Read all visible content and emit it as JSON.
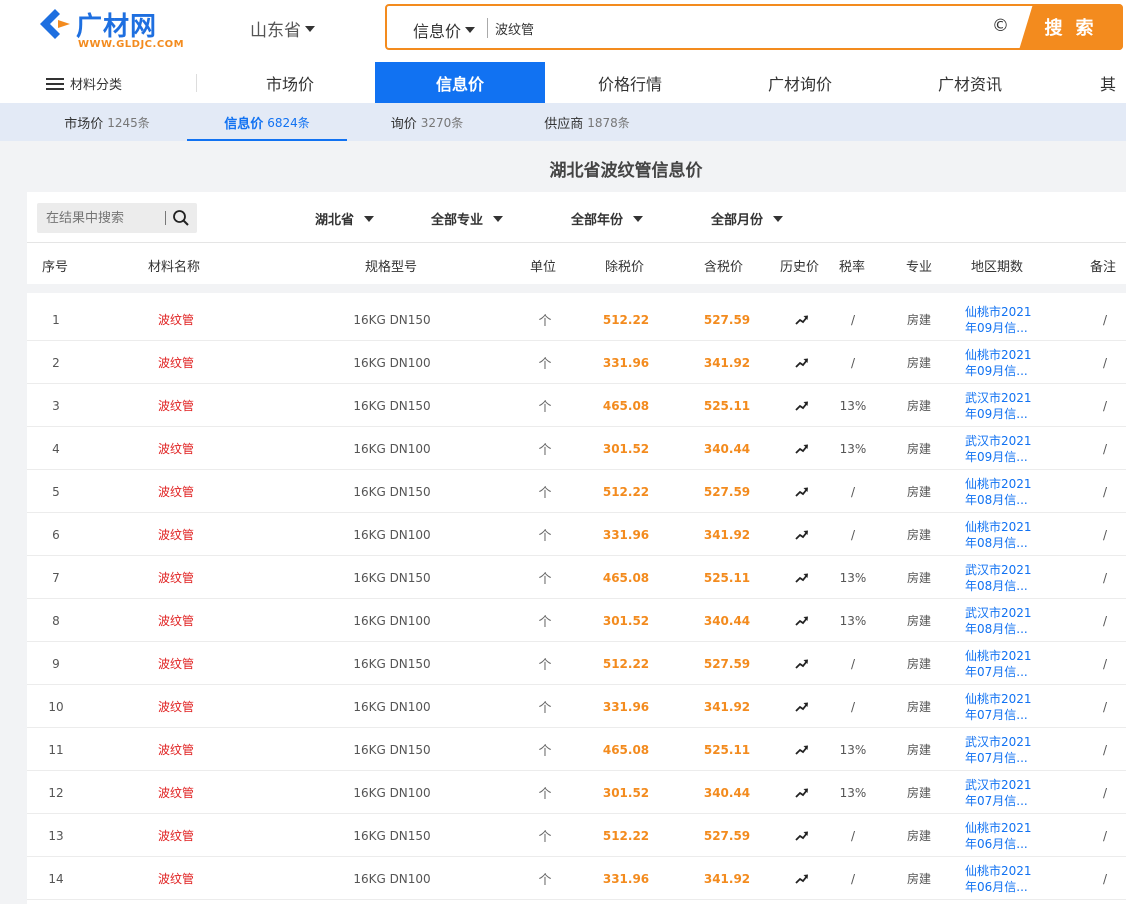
{
  "header": {
    "logo_text": "广材网",
    "logo_url": "WWW.GLDJC.COM",
    "province": "山东省",
    "search_type": "信息价",
    "search_value": "波纹管",
    "search_button": "搜 索"
  },
  "nav": {
    "category": "材料分类",
    "items": [
      {
        "label": "市场价"
      },
      {
        "label": "信息价"
      },
      {
        "label": "价格行情"
      },
      {
        "label": "广材询价"
      },
      {
        "label": "广材资讯"
      },
      {
        "label": "其"
      }
    ],
    "active_index": 1
  },
  "subtabs": [
    {
      "label": "市场价",
      "count": "1245条"
    },
    {
      "label": "信息价",
      "count": "6824条"
    },
    {
      "label": "询价",
      "count": "3270条"
    },
    {
      "label": "供应商",
      "count": "1878条"
    }
  ],
  "page_title": "湖北省波纹管信息价",
  "filters": {
    "search_placeholder": "在结果中搜索",
    "region": "湖北省",
    "major": "全部专业",
    "year": "全部年份",
    "month": "全部月份"
  },
  "columns": [
    "序号",
    "材料名称",
    "规格型号",
    "单位",
    "除税价",
    "含税价",
    "历史价",
    "税率",
    "专业",
    "地区期数",
    "备注"
  ],
  "rows": [
    {
      "no": "1",
      "name": "波纹管",
      "spec": "16KG DN150",
      "unit": "个",
      "price": "512.22",
      "tax_price": "527.59",
      "rate": "/",
      "major": "房建",
      "region1": "仙桃市2021",
      "region2": "年09月信...",
      "note": "/"
    },
    {
      "no": "2",
      "name": "波纹管",
      "spec": "16KG DN100",
      "unit": "个",
      "price": "331.96",
      "tax_price": "341.92",
      "rate": "/",
      "major": "房建",
      "region1": "仙桃市2021",
      "region2": "年09月信...",
      "note": "/"
    },
    {
      "no": "3",
      "name": "波纹管",
      "spec": "16KG DN150",
      "unit": "个",
      "price": "465.08",
      "tax_price": "525.11",
      "rate": "13%",
      "major": "房建",
      "region1": "武汉市2021",
      "region2": "年09月信...",
      "note": "/"
    },
    {
      "no": "4",
      "name": "波纹管",
      "spec": "16KG DN100",
      "unit": "个",
      "price": "301.52",
      "tax_price": "340.44",
      "rate": "13%",
      "major": "房建",
      "region1": "武汉市2021",
      "region2": "年09月信...",
      "note": "/"
    },
    {
      "no": "5",
      "name": "波纹管",
      "spec": "16KG DN150",
      "unit": "个",
      "price": "512.22",
      "tax_price": "527.59",
      "rate": "/",
      "major": "房建",
      "region1": "仙桃市2021",
      "region2": "年08月信...",
      "note": "/"
    },
    {
      "no": "6",
      "name": "波纹管",
      "spec": "16KG DN100",
      "unit": "个",
      "price": "331.96",
      "tax_price": "341.92",
      "rate": "/",
      "major": "房建",
      "region1": "仙桃市2021",
      "region2": "年08月信...",
      "note": "/"
    },
    {
      "no": "7",
      "name": "波纹管",
      "spec": "16KG DN150",
      "unit": "个",
      "price": "465.08",
      "tax_price": "525.11",
      "rate": "13%",
      "major": "房建",
      "region1": "武汉市2021",
      "region2": "年08月信...",
      "note": "/"
    },
    {
      "no": "8",
      "name": "波纹管",
      "spec": "16KG DN100",
      "unit": "个",
      "price": "301.52",
      "tax_price": "340.44",
      "rate": "13%",
      "major": "房建",
      "region1": "武汉市2021",
      "region2": "年08月信...",
      "note": "/"
    },
    {
      "no": "9",
      "name": "波纹管",
      "spec": "16KG DN150",
      "unit": "个",
      "price": "512.22",
      "tax_price": "527.59",
      "rate": "/",
      "major": "房建",
      "region1": "仙桃市2021",
      "region2": "年07月信...",
      "note": "/"
    },
    {
      "no": "10",
      "name": "波纹管",
      "spec": "16KG DN100",
      "unit": "个",
      "price": "331.96",
      "tax_price": "341.92",
      "rate": "/",
      "major": "房建",
      "region1": "仙桃市2021",
      "region2": "年07月信...",
      "note": "/"
    },
    {
      "no": "11",
      "name": "波纹管",
      "spec": "16KG DN150",
      "unit": "个",
      "price": "465.08",
      "tax_price": "525.11",
      "rate": "13%",
      "major": "房建",
      "region1": "武汉市2021",
      "region2": "年07月信...",
      "note": "/"
    },
    {
      "no": "12",
      "name": "波纹管",
      "spec": "16KG DN100",
      "unit": "个",
      "price": "301.52",
      "tax_price": "340.44",
      "rate": "13%",
      "major": "房建",
      "region1": "武汉市2021",
      "region2": "年07月信...",
      "note": "/"
    },
    {
      "no": "13",
      "name": "波纹管",
      "spec": "16KG DN150",
      "unit": "个",
      "price": "512.22",
      "tax_price": "527.59",
      "rate": "/",
      "major": "房建",
      "region1": "仙桃市2021",
      "region2": "年06月信...",
      "note": "/"
    },
    {
      "no": "14",
      "name": "波纹管",
      "spec": "16KG DN100",
      "unit": "个",
      "price": "331.96",
      "tax_price": "341.92",
      "rate": "/",
      "major": "房建",
      "region1": "仙桃市2021",
      "region2": "年06月信...",
      "note": "/"
    }
  ],
  "colors": {
    "brand_blue": "#1172f2",
    "accent_orange": "#f38b1e",
    "name_red": "#e02020"
  }
}
